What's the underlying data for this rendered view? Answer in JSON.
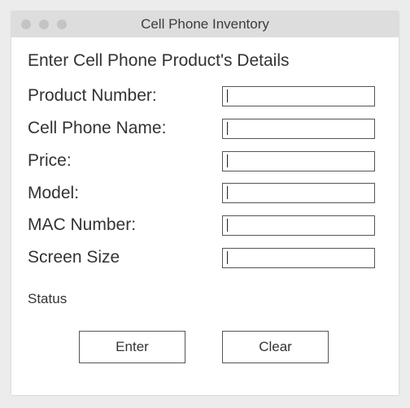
{
  "window": {
    "title": "Cell Phone Inventory"
  },
  "form": {
    "heading": "Enter Cell Phone Product's Details",
    "fields": [
      {
        "label": "Product Number:",
        "value": ""
      },
      {
        "label": "Cell Phone Name:",
        "value": ""
      },
      {
        "label": "Price:",
        "value": ""
      },
      {
        "label": "Model:",
        "value": ""
      },
      {
        "label": "MAC Number:",
        "value": ""
      },
      {
        "label": "Screen Size",
        "value": ""
      }
    ],
    "status": "Status"
  },
  "buttons": {
    "enter": "Enter",
    "clear": "Clear"
  }
}
